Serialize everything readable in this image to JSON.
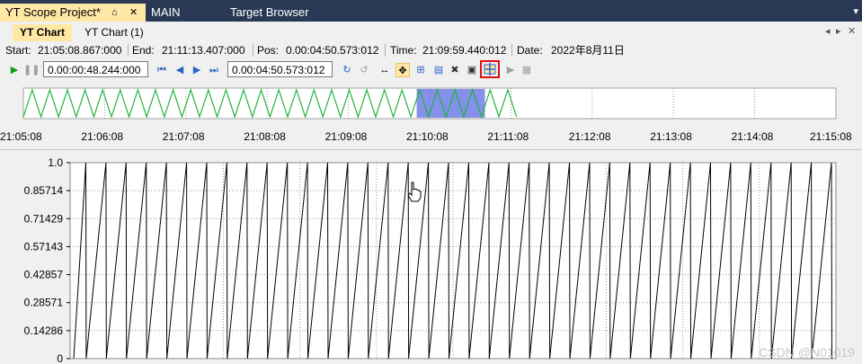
{
  "doc_tabs": {
    "active_title": "YT Scope Project*",
    "pin_glyph": "⌂",
    "close_glyph": "✕",
    "tab2": "MAIN",
    "tab3": "Target Browser",
    "dropdown_glyph": "▾"
  },
  "inner_tabs": {
    "active": "YT Chart",
    "second": "YT Chart (1)",
    "left_arrow": "◂",
    "right_arrow": "▸",
    "close": "✕"
  },
  "info": {
    "start_label": "Start:",
    "start_value": "21:05:08.867:000",
    "end_label": "End:",
    "end_value": "21:11:13.407:000",
    "pos_label": "Pos:",
    "pos_value": "0.00:04:50.573:012",
    "time_label": "Time:",
    "time_value": "21:09:59.440:012",
    "date_label": "Date:",
    "date_value": "2022年8月11日"
  },
  "toolbar": {
    "duration_value": "0.00:00:48.244:000",
    "position_value": "0.00:04:50.573:012",
    "icons": [
      "play-icon",
      "pause-icon",
      "first-icon",
      "prev-icon",
      "next-icon",
      "last-icon",
      "refresh-icon",
      "redo-icon",
      "pan-icon",
      "move-icon",
      "zoom-icon",
      "axis-icon",
      "cursor-off-icon",
      "lock-icon",
      "chart-split-icon",
      "highlighted-export-icon",
      "export-icon",
      "screen-icon"
    ]
  },
  "overview": {
    "x_ticks": [
      "21:05:08",
      "21:06:08",
      "21:07:08",
      "21:08:08",
      "21:09:08",
      "21:10:08",
      "21:11:08",
      "21:12:08",
      "21:13:08",
      "21:14:08",
      "21:15:08"
    ],
    "signal_color": "#1fb43a",
    "selection_color": "#6f7de6",
    "selection_start_fraction": 0.484,
    "selection_end_fraction": 0.568,
    "data_end_fraction": 0.607,
    "cycles": 28
  },
  "chart_data": {
    "type": "line",
    "title": "",
    "xlabel": "",
    "ylabel": "",
    "ylim": [
      0,
      1.0
    ],
    "y_ticks": [
      "1.0",
      "0.85714",
      "0.71429",
      "0.57143",
      "0.42857",
      "0.28571",
      "0.14286",
      "0"
    ],
    "series": [
      {
        "values": [
          0,
          1.0,
          0,
          1.0,
          0,
          1.0,
          0,
          1.0,
          0,
          1.0
        ],
        "color": "#000000"
      }
    ],
    "sawtooth_periods": 38,
    "grid": true
  },
  "watermark": "CSDN @N01019"
}
